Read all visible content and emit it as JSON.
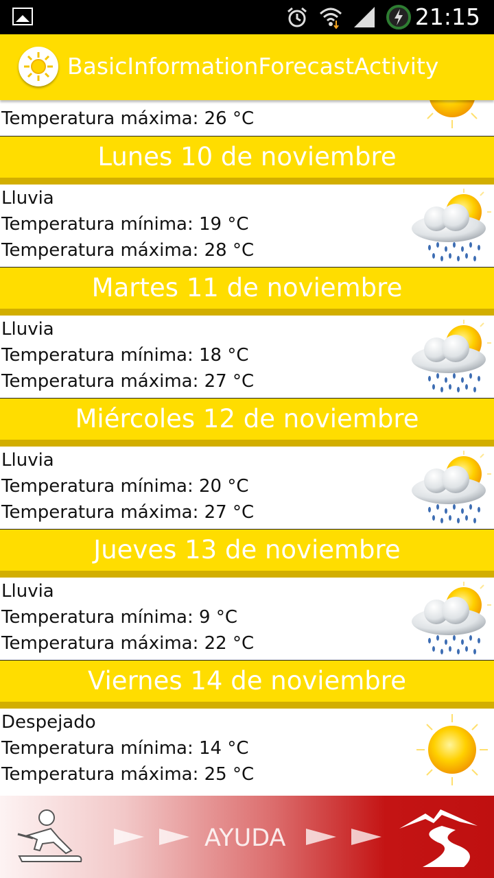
{
  "status_bar": {
    "time": "21:15"
  },
  "action_bar": {
    "title": "BasicInformationForecastActivity"
  },
  "partial_item": {
    "max_temp": "Temperatura máxima: 26 °C"
  },
  "forecast": [
    {
      "day": "Lunes 10 de noviembre",
      "condition": "Lluvia",
      "min_temp": "Temperatura mínima: 19 °C",
      "max_temp": "Temperatura máxima: 28 °C",
      "icon": "rain-sun-icon"
    },
    {
      "day": "Martes 11 de noviembre",
      "condition": "Lluvia",
      "min_temp": "Temperatura mínima: 18 °C",
      "max_temp": "Temperatura máxima: 27 °C",
      "icon": "rain-sun-icon"
    },
    {
      "day": "Miércoles 12 de noviembre",
      "condition": "Lluvia",
      "min_temp": "Temperatura mínima: 20 °C",
      "max_temp": "Temperatura máxima: 27 °C",
      "icon": "rain-sun-icon"
    },
    {
      "day": "Jueves 13 de noviembre",
      "condition": "Lluvia",
      "min_temp": "Temperatura mínima: 9 °C",
      "max_temp": "Temperatura máxima: 22 °C",
      "icon": "rain-sun-icon"
    },
    {
      "day": "Viernes 14 de noviembre",
      "condition": "Despejado",
      "min_temp": "Temperatura mínima: 14 °C",
      "max_temp": "Temperatura máxima: 25 °C",
      "icon": "sun-icon"
    }
  ],
  "banner": {
    "help_label": "AYUDA"
  },
  "colors": {
    "accent": "#ffdd00",
    "header_bar": "#d2ae00",
    "banner_red": "#c41414"
  }
}
